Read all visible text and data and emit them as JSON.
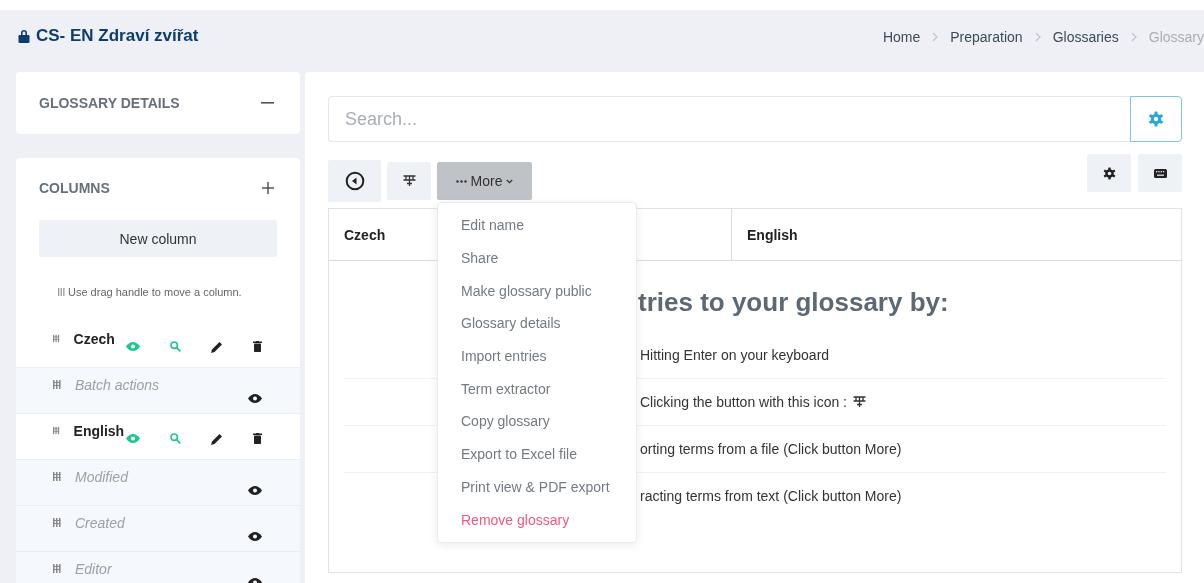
{
  "header": {
    "title": "CS- EN Zdraví zvířat",
    "breadcrumb": [
      {
        "label": "Home",
        "current": false
      },
      {
        "label": "Preparation",
        "current": false
      },
      {
        "label": "Glossaries",
        "current": false
      },
      {
        "label": "Glossary",
        "current": true
      }
    ]
  },
  "sidebar": {
    "details_card": {
      "title": "GLOSSARY DETAILS"
    },
    "columns_card": {
      "title": "COLUMNS",
      "new_column_button": "New column",
      "hint": "Use drag handle to move a column.",
      "columns": [
        {
          "name": "Czech",
          "kind": "language"
        },
        {
          "name": "Batch actions",
          "kind": "meta"
        },
        {
          "name": "English",
          "kind": "language"
        },
        {
          "name": "Modified",
          "kind": "meta"
        },
        {
          "name": "Created",
          "kind": "meta"
        },
        {
          "name": "Editor",
          "kind": "meta"
        }
      ]
    }
  },
  "main": {
    "search": {
      "placeholder": "Search..."
    },
    "toolbar": {
      "more_button": "More"
    },
    "more_menu": [
      {
        "label": "Edit name",
        "kind": "normal"
      },
      {
        "label": "Share",
        "kind": "normal"
      },
      {
        "label": "Make glossary public",
        "kind": "normal"
      },
      {
        "label": "Glossary details",
        "kind": "normal"
      },
      {
        "label": "Import entries",
        "kind": "normal"
      },
      {
        "label": "Term extractor",
        "kind": "normal"
      },
      {
        "label": "Copy glossary",
        "kind": "normal"
      },
      {
        "label": "Export to Excel file",
        "kind": "normal"
      },
      {
        "label": "Print view & PDF export",
        "kind": "normal"
      },
      {
        "label": "Remove glossary",
        "kind": "danger"
      }
    ],
    "table": {
      "columns": [
        "Czech",
        "English"
      ]
    },
    "empty_state": {
      "heading": "tries to your glossary by:",
      "steps": [
        {
          "text": "Hitting Enter on your keyboard",
          "kind": "text"
        },
        {
          "text": "Clicking the button with this icon :",
          "kind": "icon"
        },
        {
          "text": "orting terms from a file (Click button More)",
          "kind": "text"
        },
        {
          "text": "racting terms from text (Click button More)",
          "kind": "text"
        }
      ]
    }
  }
}
